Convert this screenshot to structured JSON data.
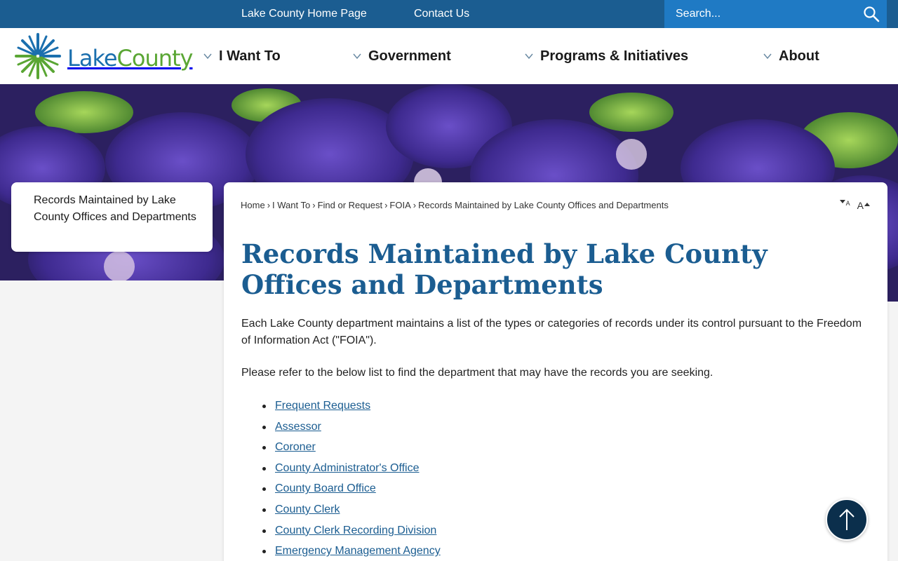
{
  "utility_nav": {
    "home_link": "Lake County Home Page",
    "contact_link": "Contact Us",
    "search_placeholder": "Search..."
  },
  "brand": {
    "name_part1": "Lake",
    "name_part2": "County",
    "colors": {
      "blue": "#1b6fae",
      "green": "#5aa634",
      "topbar": "#1b5d91"
    }
  },
  "main_nav": {
    "items": [
      {
        "label": "I Want To"
      },
      {
        "label": "Government"
      },
      {
        "label": "Programs & Initiatives"
      },
      {
        "label": "About"
      }
    ]
  },
  "side_nav": {
    "active_item": "Records Maintained by Lake County Offices and Departments"
  },
  "breadcrumb": {
    "items": [
      "Home",
      "I Want To",
      "Find or Request",
      "FOIA",
      "Records Maintained by Lake County Offices and Departments"
    ],
    "separator": "›"
  },
  "font_controls": {
    "decrease_label": "A",
    "increase_label": "A"
  },
  "page": {
    "title": "Records Maintained by Lake County Offices and Departments",
    "intro": "Each Lake County department maintains a list of the types or categories of records under its control pursuant to the Freedom of Information Act (\"FOIA\").",
    "instruction": "Please refer to the below list to find the department that may have the records you are seeking.",
    "departments": [
      "Frequent Requests",
      "Assessor",
      "Coroner",
      "County Administrator's Office",
      "County Board Office",
      "County Clerk",
      "County Clerk Recording Division",
      "Emergency Management Agency"
    ]
  },
  "icons": {
    "search": "search-icon",
    "chevron": "chevron-down-icon",
    "logo": "starburst-logo-icon",
    "back_to_top": "arrow-up-icon"
  }
}
